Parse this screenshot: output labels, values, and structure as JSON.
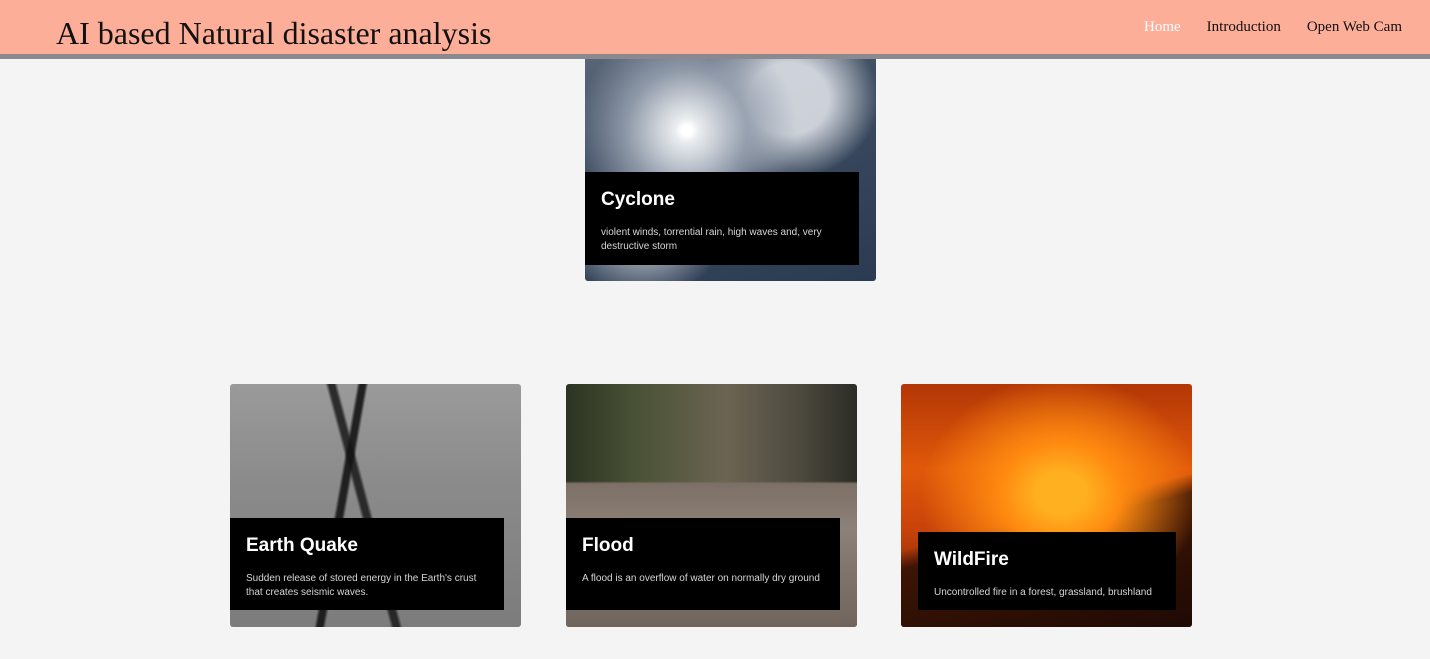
{
  "header": {
    "title": "AI based Natural disaster analysis",
    "nav": [
      {
        "label": "Home",
        "active": true
      },
      {
        "label": "Introduction",
        "active": false
      },
      {
        "label": "Open Web Cam",
        "active": false
      }
    ],
    "background_color": "#fdae98",
    "active_link_color": "#ffffff"
  },
  "cards": [
    {
      "title": "Cyclone",
      "description": "violent winds, torrential rain, high waves and, very destructive storm"
    },
    {
      "title": "Earth Quake",
      "description": "Sudden release of stored energy in the Earth's crust that creates seismic waves."
    },
    {
      "title": "Flood",
      "description": "A flood is an overflow of water on normally dry ground"
    },
    {
      "title": "WildFire",
      "description": "Uncontrolled fire in a forest, grassland, brushland"
    }
  ]
}
